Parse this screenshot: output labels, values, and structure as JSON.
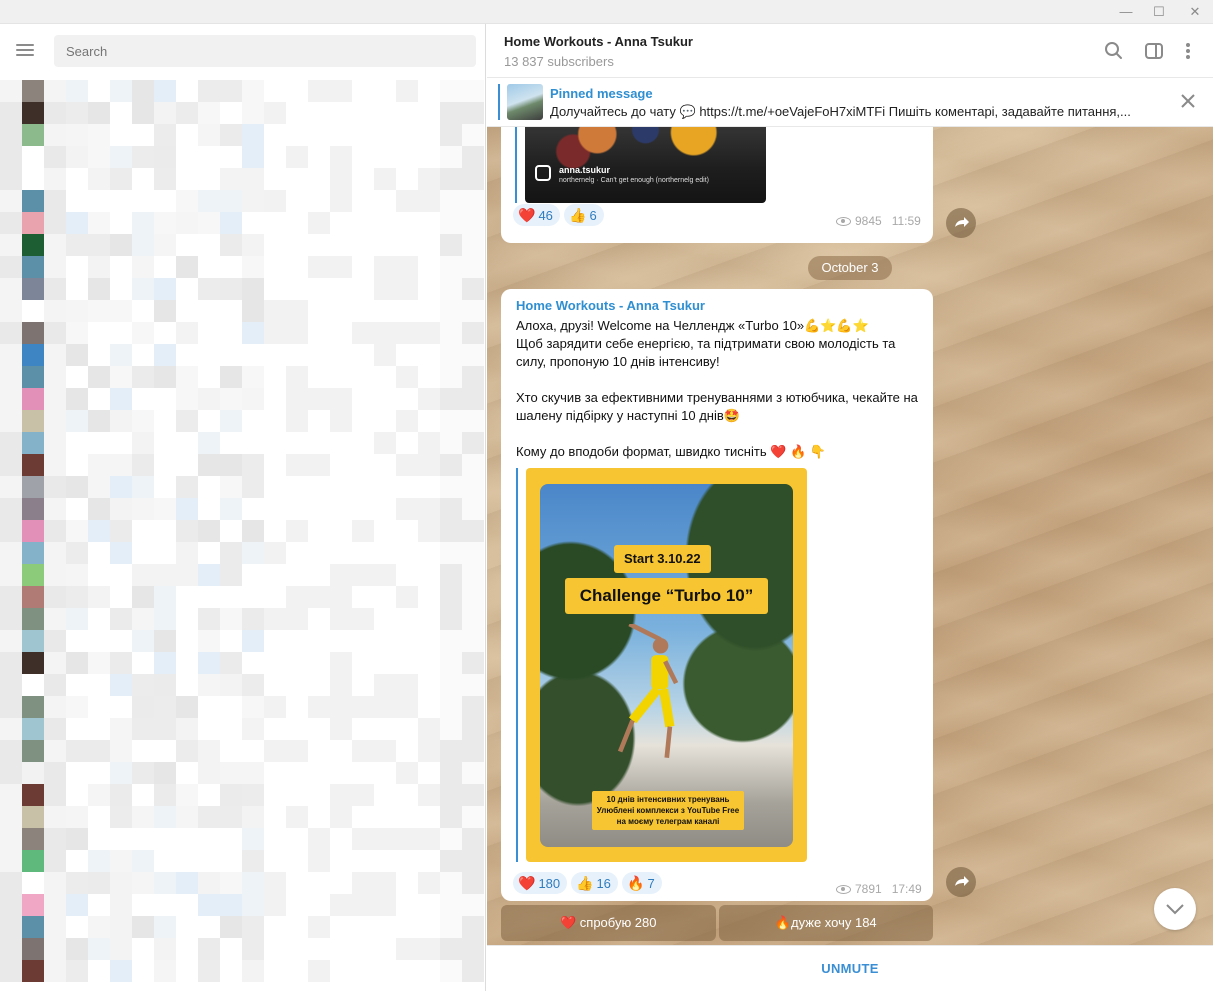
{
  "window": {
    "controls": [
      "minimize-icon",
      "maximize-icon",
      "close-icon"
    ],
    "minimize_glyph": "—",
    "maximize_glyph": "☐",
    "close_glyph": "✕"
  },
  "sidebar": {
    "search_placeholder": "Search",
    "menu_icon": "hamburger-menu-icon",
    "list_note": "chat list is pixelated / obscured"
  },
  "header": {
    "title": "Home Workouts - Anna Tsukur",
    "subscribers": "13 837 subscribers",
    "icons": [
      "search-icon",
      "sidebar-toggle-icon",
      "more-vertical-icon"
    ]
  },
  "pinned": {
    "label": "Pinned message",
    "text": "Долучайтесь до чату 💬 https://t.me/+oeVajeFoH7xiMTFi Пишіть коментарі, задавайте питання,..."
  },
  "previous_message": {
    "ig_name": "anna.tsukur",
    "ig_track": "northernelg · Can't get enough (northernelg edit)",
    "ig_handle": "anna.tsukur",
    "reactions": [
      {
        "emoji": "❤️",
        "count": "46"
      },
      {
        "emoji": "👍",
        "count": "6"
      }
    ],
    "views": "9845",
    "time": "11:59"
  },
  "date_separator": "October 3",
  "message": {
    "author": "Home Workouts - Anna Tsukur",
    "text": "Алоха, друзі! Welcome на Челлендж «Turbo 10»💪⭐💪⭐\nЩоб зарядити себе енергією, та підтримати свою молодість та силу, пропоную 10 днів інтенсиву!\n\nХто скучив за ефективними тренуваннями з ютюбчика, чекайте на шалену підбірку у наступні 10 днів🤩\n\nКому до вподоби формат, швидко тисніть ❤️ 🔥 👇",
    "poster": {
      "start": "Start 3.10.22",
      "challenge": "Challenge “Turbo 10”",
      "note": "10 днів інтенсивних тренувань Улюблені комплекси з YouTube Free на моєму телеграм каналі"
    },
    "reactions": [
      {
        "emoji": "❤️",
        "count": "180"
      },
      {
        "emoji": "👍",
        "count": "16"
      },
      {
        "emoji": "🔥",
        "count": "7"
      }
    ],
    "views": "7891",
    "time": "17:49",
    "buttons": [
      {
        "label": "❤️ спробую 280"
      },
      {
        "label": "🔥дуже хочу 184"
      }
    ]
  },
  "footer": {
    "unmute": "UNMUTE"
  },
  "colors": {
    "accent": "#3a8fd4",
    "link_blue": "#2f8fd1",
    "poster_yellow": "#f7c531"
  }
}
